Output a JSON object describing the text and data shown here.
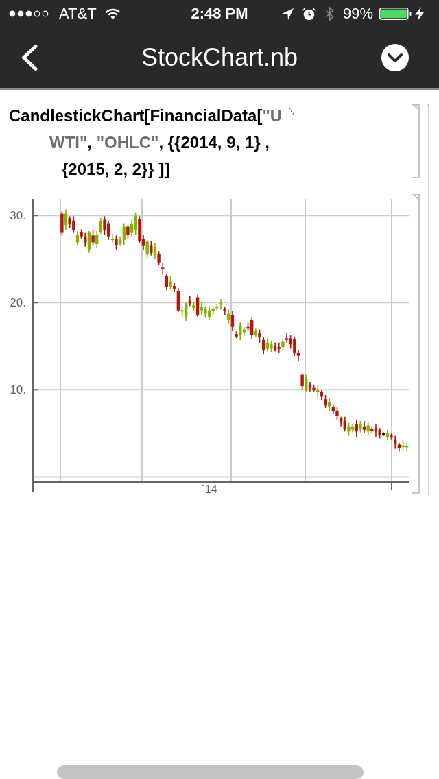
{
  "status_bar": {
    "carrier": "AT&T",
    "time": "2:48 PM",
    "battery": "99%"
  },
  "nav_bar": {
    "title": "StockChart.nb"
  },
  "input_cell": {
    "lines": [
      {
        "segments": [
          {
            "kind": "code",
            "text": "CandlestickChart[FinancialData["
          },
          {
            "kind": "string",
            "text": "\"U"
          }
        ],
        "continuation_mark": true
      },
      {
        "segments": [
          {
            "kind": "string",
            "text": "WTI\""
          },
          {
            "kind": "code",
            "text": ", "
          },
          {
            "kind": "string",
            "text": "\"OHLC\""
          },
          {
            "kind": "code",
            "text": ", {{2014, 9, 1} ,"
          }
        ],
        "continuation_mark": false
      },
      {
        "segments": [
          {
            "kind": "code",
            "text": "{2015, 2, 2}} ]]"
          }
        ],
        "continuation_mark": false
      }
    ]
  },
  "output_cell": {
    "chart_data": {
      "type": "candlestick",
      "grid": true,
      "categories": [
        null,
        null,
        null,
        null,
        null,
        null,
        null,
        null,
        null,
        null,
        null,
        null,
        null,
        null,
        null,
        null,
        null,
        null,
        null,
        null,
        null,
        null,
        null,
        null,
        null,
        null,
        null,
        null,
        null,
        null,
        null,
        null,
        null,
        null,
        null,
        null,
        null,
        null,
        null,
        null,
        null,
        null,
        null,
        null,
        null,
        "`14",
        null,
        null,
        null,
        null,
        null,
        null,
        null,
        null,
        null,
        null,
        null,
        null,
        null,
        null,
        null,
        null,
        null,
        null,
        null,
        null,
        null,
        null,
        null,
        null,
        null,
        null,
        null,
        null,
        null,
        null,
        null,
        null,
        null,
        null,
        null,
        null,
        null,
        null,
        null,
        null,
        null,
        null,
        null,
        null,
        null,
        null,
        null,
        null,
        null,
        null,
        null
      ],
      "ohlc": [
        null,
        null,
        null,
        null,
        null,
        null,
        null,
        [
          30.2,
          30.5,
          27.7,
          28.0
        ],
        [
          28.9,
          30.7,
          28.3,
          30.2
        ],
        [
          29.7,
          29.9,
          28.6,
          29.0
        ],
        [
          29.4,
          29.9,
          28.0,
          28.3
        ],
        [
          26.9,
          28.2,
          26.5,
          27.8
        ],
        [
          28.1,
          28.4,
          27.3,
          27.6
        ],
        [
          27.6,
          28.0,
          26.4,
          26.9
        ],
        [
          26.1,
          28.2,
          25.7,
          28.0
        ],
        [
          27.7,
          28.3,
          26.6,
          26.9
        ],
        [
          26.7,
          28.2,
          26.2,
          27.8
        ],
        [
          28.1,
          29.7,
          27.9,
          29.4
        ],
        [
          29.5,
          29.9,
          27.8,
          28.3
        ],
        [
          29.1,
          29.3,
          27.2,
          27.6
        ],
        [
          27.2,
          27.9,
          26.9,
          27.3
        ],
        [
          27.3,
          27.7,
          26.1,
          26.6
        ],
        [
          26.7,
          27.6,
          26.5,
          27.2
        ],
        [
          27.2,
          29.1,
          26.6,
          28.7
        ],
        [
          28.7,
          28.9,
          27.4,
          27.8
        ],
        [
          28.0,
          29.5,
          27.6,
          29.0
        ],
        [
          28.3,
          30.3,
          27.8,
          29.9
        ],
        [
          29.6,
          29.9,
          26.8,
          27.0
        ],
        [
          27.3,
          27.8,
          26.0,
          26.5
        ],
        [
          25.5,
          27.2,
          25.1,
          27.0
        ],
        [
          26.5,
          27.1,
          25.4,
          25.7
        ],
        [
          25.4,
          26.8,
          25.0,
          26.4
        ],
        [
          25.6,
          25.9,
          24.3,
          24.6
        ],
        [
          24.0,
          24.5,
          23.2,
          23.8
        ],
        [
          23.1,
          23.3,
          21.4,
          21.8
        ],
        [
          21.8,
          23.0,
          21.5,
          22.4
        ],
        [
          21.9,
          22.3,
          21.2,
          21.6
        ],
        [
          21.3,
          21.7,
          18.9,
          19.1
        ],
        [
          19.0,
          19.6,
          18.4,
          19.1
        ],
        [
          18.3,
          20.0,
          17.9,
          19.8
        ],
        [
          20.2,
          20.8,
          19.6,
          19.9
        ],
        [
          19.4,
          20.1,
          19.0,
          19.7
        ],
        [
          20.6,
          20.9,
          18.3,
          18.5
        ],
        [
          19.1,
          20.0,
          18.6,
          19.5
        ],
        [
          18.7,
          19.5,
          18.3,
          19.3
        ],
        [
          18.3,
          19.6,
          18.0,
          19.1
        ],
        [
          19.1,
          19.6,
          18.6,
          19.2
        ],
        [
          19.4,
          19.8,
          19.1,
          19.5
        ],
        [
          19.8,
          20.4,
          19.2,
          19.9
        ],
        [
          19.3,
          19.5,
          18.6,
          19.0
        ],
        [
          18.0,
          19.2,
          17.6,
          18.7
        ],
        [
          18.6,
          19.0,
          16.7,
          17.2
        ],
        [
          16.4,
          16.7,
          15.9,
          16.1
        ],
        [
          16.3,
          17.8,
          15.7,
          17.3
        ],
        [
          16.6,
          17.2,
          16.2,
          16.9
        ],
        [
          17.2,
          17.7,
          16.7,
          17.0
        ],
        [
          18.0,
          18.3,
          15.8,
          16.3
        ],
        [
          16.3,
          17.0,
          16.1,
          16.7
        ],
        [
          16.5,
          16.9,
          15.4,
          16.0
        ],
        [
          15.7,
          16.0,
          14.1,
          14.5
        ],
        [
          14.7,
          15.9,
          14.4,
          15.4
        ],
        [
          14.7,
          15.6,
          14.3,
          15.2
        ],
        [
          15.0,
          15.4,
          14.4,
          14.6
        ],
        [
          14.9,
          15.4,
          14.2,
          14.7
        ],
        [
          14.9,
          15.7,
          14.5,
          15.5
        ],
        [
          15.9,
          16.5,
          15.4,
          15.7
        ],
        [
          15.9,
          16.3,
          14.7,
          15.2
        ],
        [
          15.8,
          16.1,
          13.9,
          14.2
        ],
        [
          14.2,
          14.6,
          13.3,
          13.9
        ],
        [
          11.7,
          11.9,
          10.0,
          10.4
        ],
        [
          10.0,
          11.7,
          9.7,
          11.2
        ],
        [
          10.6,
          10.9,
          9.8,
          10.2
        ],
        [
          10.2,
          10.5,
          9.8,
          10.0
        ],
        [
          9.7,
          10.5,
          9.1,
          10.0
        ],
        [
          9.8,
          10.0,
          8.8,
          9.2
        ],
        [
          8.9,
          9.4,
          7.9,
          8.2
        ],
        [
          8.1,
          9.0,
          7.6,
          8.6
        ],
        [
          8.0,
          8.3,
          7.2,
          7.5
        ],
        [
          7.6,
          8.0,
          6.5,
          7.0
        ],
        [
          6.7,
          6.9,
          5.8,
          6.2
        ],
        [
          6.4,
          6.9,
          5.2,
          5.5
        ],
        [
          5.2,
          6.2,
          4.7,
          5.8
        ],
        [
          5.4,
          6.1,
          5.1,
          5.8
        ],
        [
          6.0,
          6.5,
          4.6,
          5.2
        ],
        [
          5.5,
          6.4,
          5.1,
          6.1
        ],
        [
          5.8,
          6.4,
          5.0,
          5.4
        ],
        [
          5.2,
          6.3,
          4.7,
          5.9
        ],
        [
          5.5,
          5.8,
          5.0,
          5.3
        ],
        [
          5.6,
          6.1,
          4.6,
          5.2
        ],
        [
          5.4,
          5.6,
          4.4,
          4.8
        ],
        [
          4.9,
          5.1,
          4.7,
          4.9
        ],
        [
          4.6,
          5.4,
          4.2,
          5.0
        ],
        [
          4.7,
          5.0,
          4.3,
          4.6
        ],
        [
          4.3,
          4.7,
          3.2,
          3.8
        ],
        [
          3.7,
          3.9,
          2.9,
          3.3
        ],
        [
          3.4,
          4.2,
          3.1,
          3.6
        ],
        [
          3.4,
          3.9,
          2.9,
          3.5
        ]
      ],
      "ylim": [
        -0.6,
        31.9
      ],
      "yticks": [
        {
          "value": 30,
          "label": "30."
        },
        {
          "value": 20,
          "label": "20."
        },
        {
          "value": 10,
          "label": "10."
        }
      ]
    }
  }
}
